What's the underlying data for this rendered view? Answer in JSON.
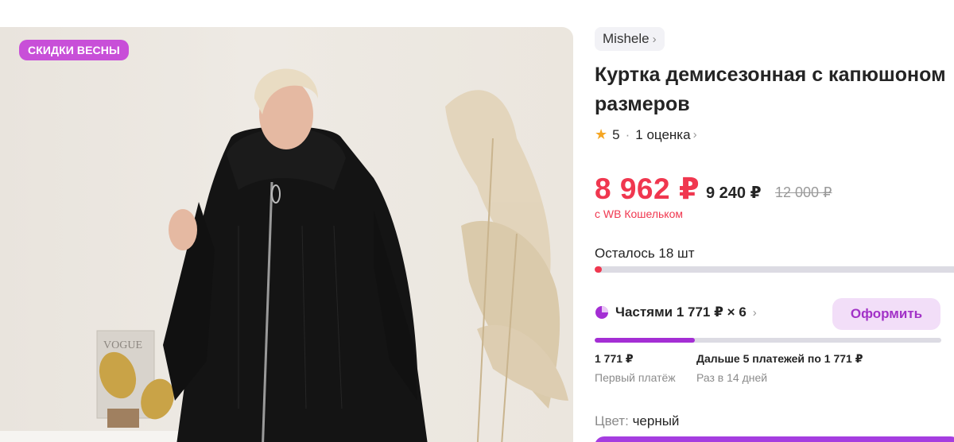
{
  "promo": {
    "badge": "СКИДКИ ВЕСНЫ"
  },
  "product": {
    "brand": "Mishele",
    "title_lines": [
      "Куртка демисезонная с капюшоном",
      "размеров"
    ],
    "rating": {
      "score": "5",
      "reviews": "1 оценка",
      "stars": 5
    },
    "price": {
      "wallet": "8 962 ₽",
      "regular": "9 240 ₽",
      "old": "12 000 ₽",
      "wallet_note": "с WB Кошельком"
    },
    "stock": {
      "text": "Осталось 18 шт",
      "fraction": 0.02
    },
    "installments": {
      "title": "Частями 1 771 ₽ × 6",
      "button": "Оформить",
      "progress_fraction": 0.29,
      "first_amount": "1 771 ₽",
      "first_label": "Первый платёж",
      "next_amount": "Дальше 5 платежей по 1 771 ₽",
      "next_label": "Раз в 14 дней"
    },
    "color": {
      "label": "Цвет:",
      "value": "черный"
    }
  },
  "icons": [
    "chevron-right-icon",
    "star-icon",
    "pie-chart-icon"
  ],
  "colors": {
    "price": "#f0374f",
    "accent": "#a232c7",
    "badge": "#c84fd8",
    "stock_fill": "#f0374f",
    "pay_fill": "#a42ed4"
  }
}
